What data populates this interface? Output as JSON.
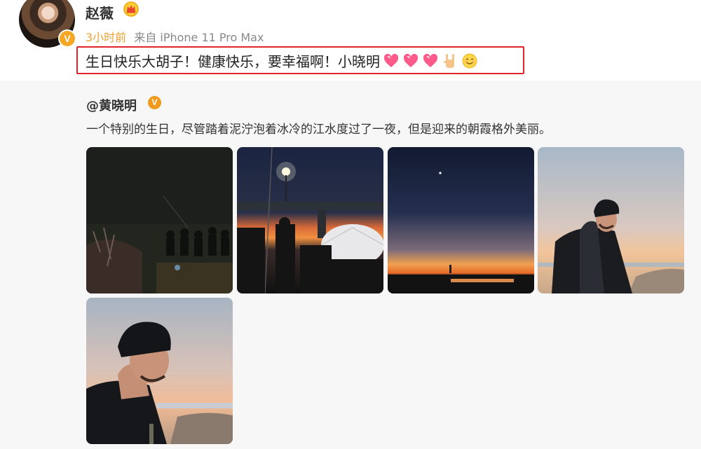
{
  "post": {
    "author_name": "赵薇",
    "verified_badge": "V",
    "time": "3小时前",
    "source": "来自 iPhone 11 Pro Max",
    "text": "生日快乐大胡子！健康快乐，要幸福啊！小晓明",
    "emojis": [
      "heart-emoji",
      "heart-emoji",
      "heart-emoji",
      "rock-hand-emoji",
      "smile-emoji"
    ],
    "highlight_color": "#e0262a"
  },
  "repost": {
    "author": "@黄晓明",
    "verified_badge": "V",
    "text": "一个特别的生日，尽管踏着泥泞泡着冰冷的江水度过了一夜，但是迎来的朝霞格外美丽。",
    "photos": [
      {
        "name": "night-crowd-riverbank-photo"
      },
      {
        "name": "bridge-night-crew-photo"
      },
      {
        "name": "dawn-sky-river-photo"
      },
      {
        "name": "man-in-beanie-photo-1"
      },
      {
        "name": "man-in-beanie-photo-2"
      }
    ]
  },
  "colors": {
    "time": "#f0a030",
    "verified": "#f5a623",
    "repost_bg": "#f7f7f7"
  }
}
